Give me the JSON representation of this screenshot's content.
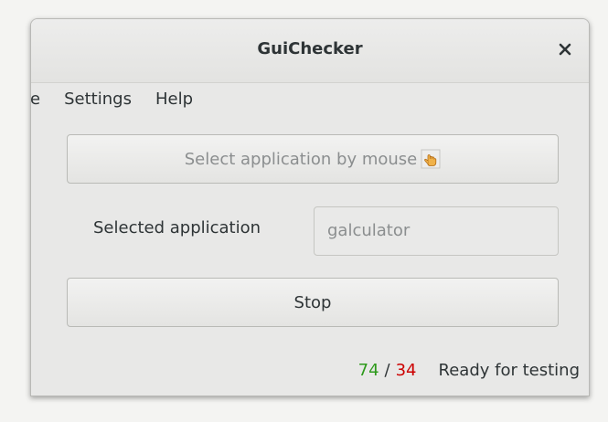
{
  "window": {
    "title": "GuiChecker",
    "close_icon": "close-icon"
  },
  "menubar": {
    "items": [
      {
        "label": "File"
      },
      {
        "label": "Settings"
      },
      {
        "label": "Help"
      }
    ]
  },
  "main": {
    "select_button_label": "Select application by mouse",
    "select_button_icon": "hand-pointer-icon",
    "selected_app_label": "Selected application",
    "selected_app_value": "galculator",
    "stop_button_label": "Stop"
  },
  "status": {
    "passed": "74",
    "separator": "/",
    "failed": "34",
    "message": "Ready for testing",
    "colors": {
      "passed": "#2e9a1c",
      "failed": "#cc0000"
    }
  }
}
